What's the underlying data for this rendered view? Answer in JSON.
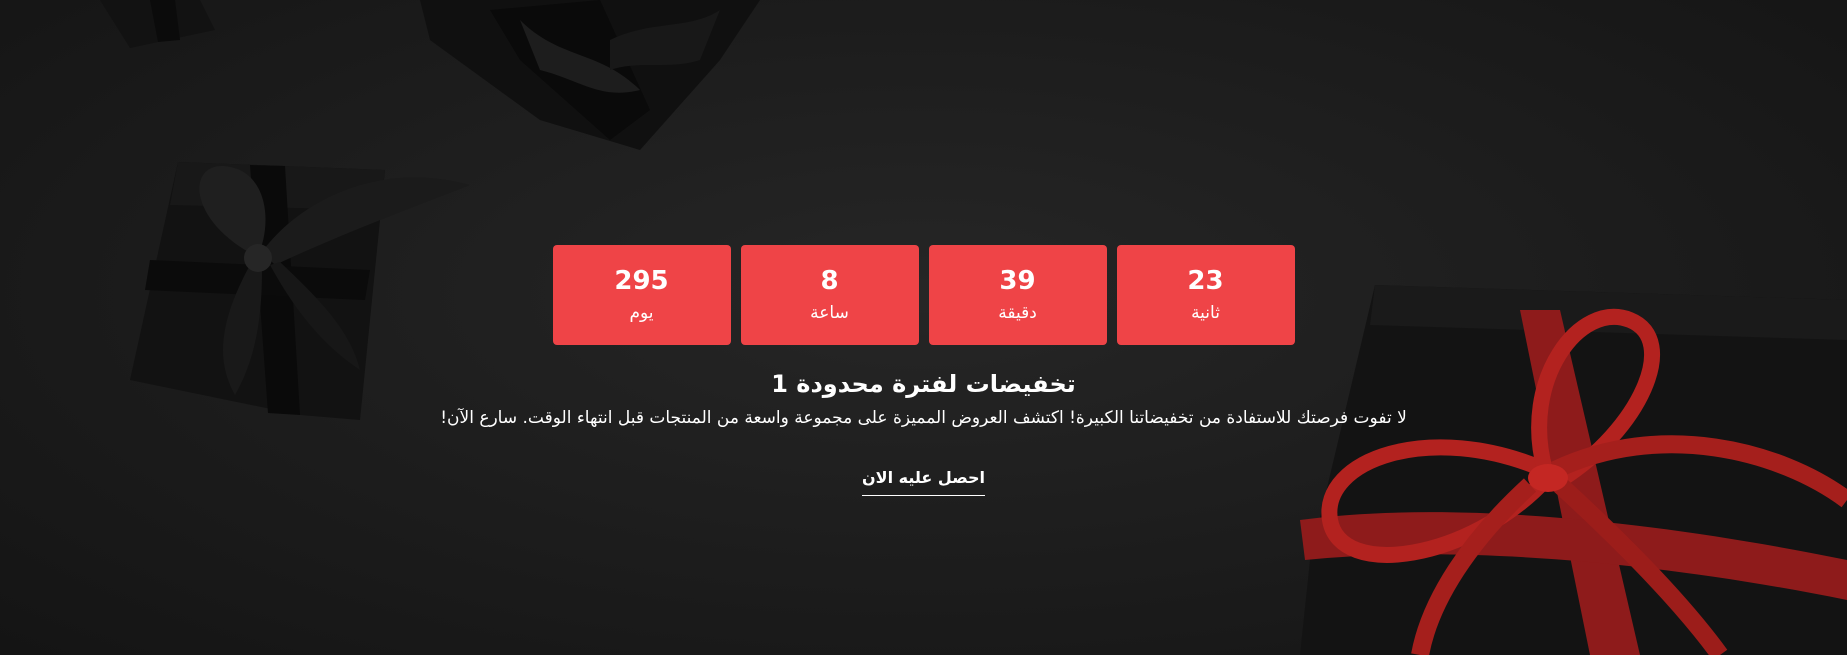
{
  "countdown": {
    "days": {
      "value": "295",
      "label": "يوم"
    },
    "hours": {
      "value": "8",
      "label": "ساعة"
    },
    "minutes": {
      "value": "39",
      "label": "دقيقة"
    },
    "seconds": {
      "value": "23",
      "label": "ثانية"
    }
  },
  "promo": {
    "title": "تخفيضات لفترة محدودة 1",
    "description": "لا تفوت فرصتك للاستفادة من تخفيضاتنا الكبيرة! اكتشف العروض المميزة على مجموعة واسعة من المنتجات قبل انتهاء الوقت. سارع الآن!",
    "cta_label": "احصل عليه الان"
  },
  "background": {
    "image": "black-gift-boxes-red-ribbon",
    "colors": {
      "base": "#1b1b1b",
      "box": "#101010",
      "ribbon": "#b3221f",
      "accent": "#ef4447"
    }
  }
}
